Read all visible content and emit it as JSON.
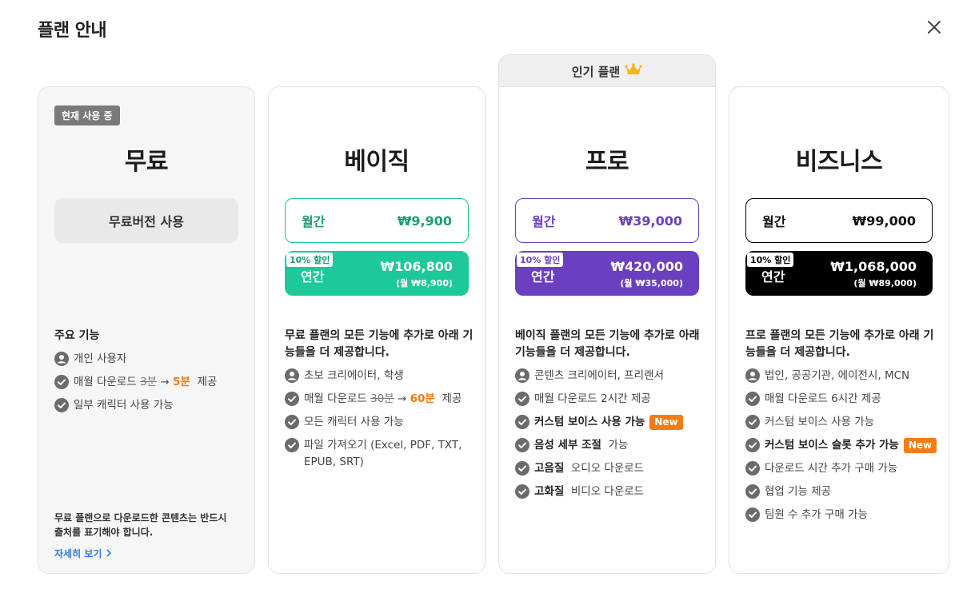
{
  "modal": {
    "title": "플랜 안내",
    "close_icon": "close-icon"
  },
  "colors": {
    "basic": "#1dbf8f",
    "pro": "#6a3fc0",
    "biz": "#000000",
    "orange": "#f07b10",
    "link": "#2a7de1"
  },
  "popular": {
    "label": "인기 플랜",
    "icon": "crown-icon"
  },
  "plans": {
    "free": {
      "badge": "현재 사용 중",
      "name": "무료",
      "button": "무료버전 사용",
      "features_title": "주요 기능",
      "f0": "개인 사용자",
      "f1_pre": "매월 다운로드",
      "f1_old": "3분",
      "f1_new": "5분",
      "f1_post": "제공",
      "f2": "일부 캐릭터 사용 가능",
      "notice": "무료 플랜으로 다운로드한 콘텐츠는 반드시 출처를 표기해야 합니다.",
      "more": "자세히 보기"
    },
    "basic": {
      "name": "베이직",
      "monthly_label": "월간",
      "monthly_price": "₩9,900",
      "discount": "10% 할인",
      "yearly_label": "연간",
      "yearly_price": "₩106,800",
      "yearly_sub": "(월 ₩8,900)",
      "features_title": "무료 플랜의 모든 기능에 추가로 아래 기능들을 더 제공합니다.",
      "f0": "초보 크리에이터, 학생",
      "f1_pre": "매월 다운로드",
      "f1_old": "30분",
      "f1_new": "60분",
      "f1_post": "제공",
      "f2": "모든 캐릭터 사용 가능",
      "f3": "파일 가져오기 (Excel, PDF, TXT, EPUB, SRT)"
    },
    "pro": {
      "name": "프로",
      "monthly_label": "월간",
      "monthly_price": "₩39,000",
      "discount": "10% 할인",
      "yearly_label": "연간",
      "yearly_price": "₩420,000",
      "yearly_sub": "(월 ₩35,000)",
      "features_title": "베이직 플랜의 모든 기능에 추가로 아래 기능들을 더 제공합니다.",
      "f0": "콘텐츠 크리에이터, 프리랜서",
      "f1": "매월 다운로드 2시간  제공",
      "f2": "커스텀 보이스 사용 가능",
      "f2_badge": "New",
      "f3_bold": "음성 세부 조절",
      "f3_rest": "가능",
      "f4_bold": "고음질",
      "f4_rest": "오디오 다운로드",
      "f5_bold": "고화질",
      "f5_rest": "비디오 다운로드"
    },
    "biz": {
      "name": "비즈니스",
      "monthly_label": "월간",
      "monthly_price": "₩99,000",
      "discount": "10% 할인",
      "yearly_label": "연간",
      "yearly_price": "₩1,068,000",
      "yearly_sub": "(월 ₩89,000)",
      "features_title": "프로 플랜의 모든 기능에 추가로 아래 기능들을 더 제공합니다.",
      "f0": "법인, 공공기관, 에이전시, MCN",
      "f1": "매월 다운로드 6시간  제공",
      "f2": "커스텀 보이스 사용 가능",
      "f3": "커스텀 보이스 슬롯 추가 가능",
      "f3_badge": "New",
      "f4": "다운로드 시간 추가 구매 가능",
      "f5": "협업 기능 제공",
      "f6": "팀원 수 추가 구매 가능"
    }
  }
}
